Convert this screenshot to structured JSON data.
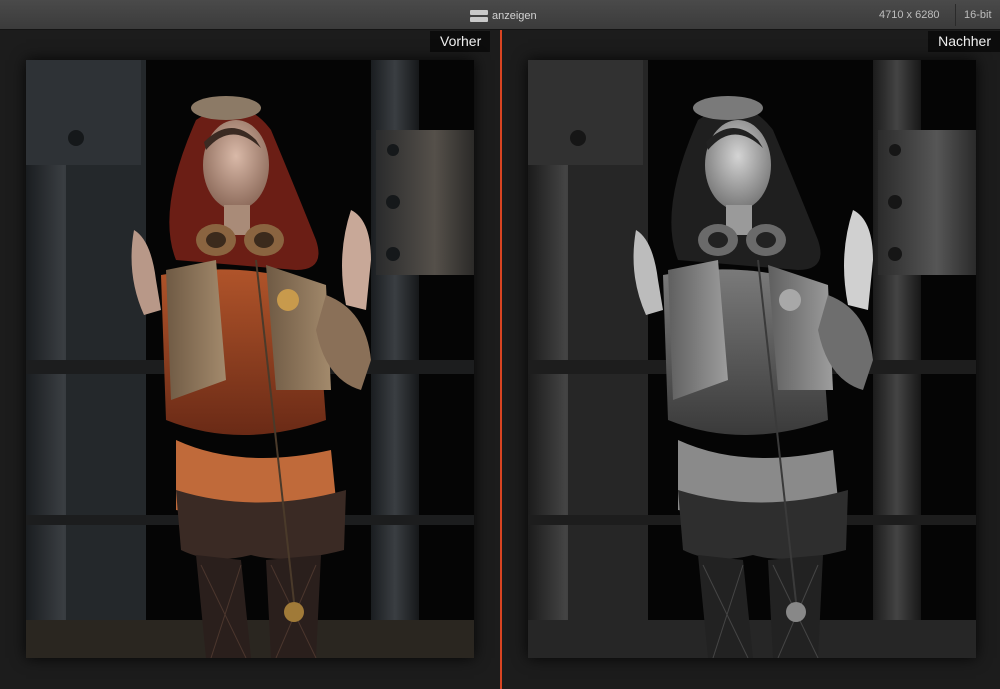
{
  "toolbar": {
    "compare_label": "anzeigen",
    "compare_icon": "split-horizontal-icon",
    "dimensions": "4710 x 6280",
    "bit_depth": "16-bit"
  },
  "before": {
    "label": "Vorher"
  },
  "after": {
    "label": "Nachher"
  },
  "colors": {
    "divider": "#d84422",
    "toolbar": "#434343",
    "background": "#1b1b1b"
  }
}
